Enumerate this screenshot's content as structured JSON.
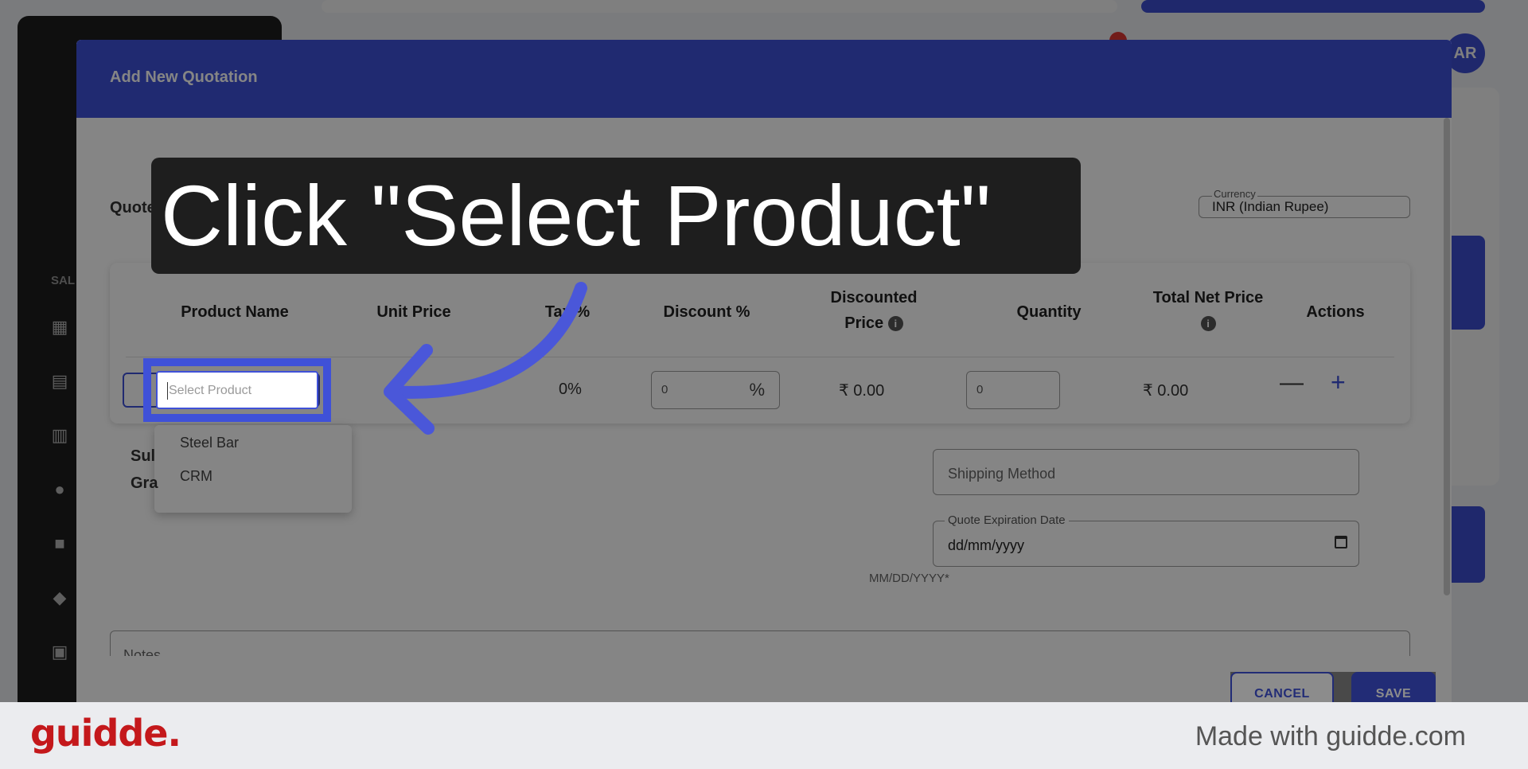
{
  "colors": {
    "accent": "#3f51d8",
    "brand": "#c4181b",
    "tooltip_bg": "#1e1e1e"
  },
  "background": {
    "sidebar_section": "SAL",
    "avatar_initials": "AR",
    "sidebar_icons": [
      "dashboard-icon",
      "calendar-icon",
      "contacts-icon",
      "people-icon",
      "folder-icon",
      "tag-icon",
      "clipboard-icon",
      "cart-icon"
    ]
  },
  "modal": {
    "title": "Add New Quotation",
    "quote_name_label": "Quote Name:",
    "currency": {
      "label": "Currency",
      "value": "INR (Indian Rupee)"
    },
    "table": {
      "headers": {
        "product_name": "Product Name",
        "unit_price": "Unit Price",
        "tax": "Tax %",
        "discount": "Discount %",
        "discounted_price_line1": "Discounted",
        "discounted_price_line2": "Price",
        "quantity": "Quantity",
        "total_net_price": "Total Net Price",
        "actions": "Actions"
      },
      "row": {
        "product_placeholder": "Select Product",
        "tax_value": "0%",
        "discount_value": "0",
        "discount_suffix": "%",
        "discounted_price": "₹ 0.00",
        "quantity_value": "0",
        "total_net_price": "₹ 0.00",
        "remove_symbol": "—",
        "add_symbol": "+"
      }
    },
    "dropdown_options": [
      "Steel Bar",
      "CRM"
    ],
    "subtotal_label": "Sul",
    "grand_total_label": "Gra",
    "shipping_method_placeholder": "Shipping Method",
    "quote_expiration": {
      "label": "Quote Expiration Date",
      "value": "dd/mm/yyyy",
      "helper": "MM/DD/YYYY*"
    },
    "notes_label": "Notes",
    "buttons": {
      "cancel": "CANCEL",
      "save": "SAVE"
    }
  },
  "annotation": {
    "instruction": "Click \"Select Product\""
  },
  "footer": {
    "logo": "guidde.",
    "made_with": "Made with guidde.com"
  }
}
